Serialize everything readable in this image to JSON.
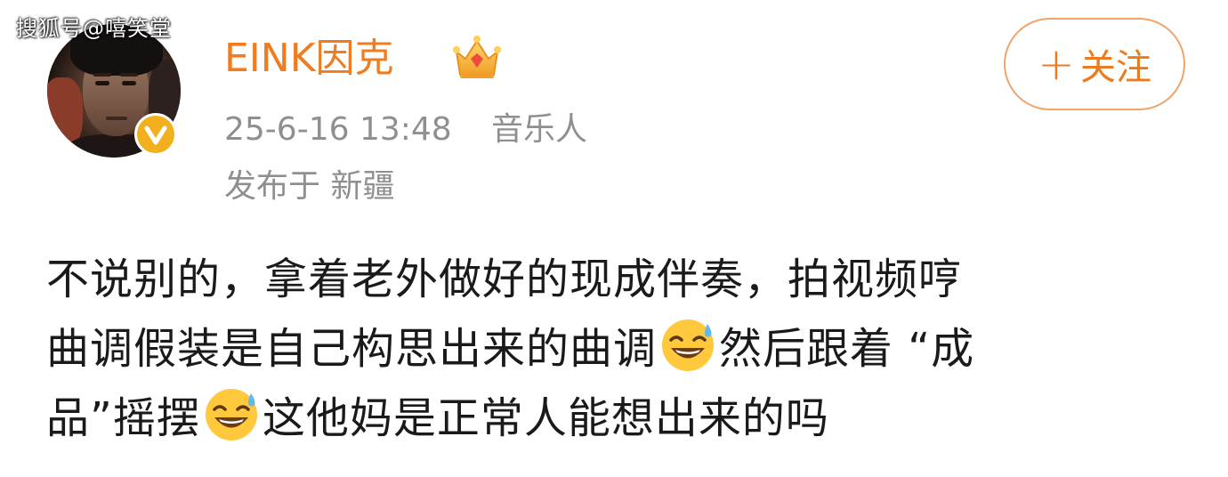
{
  "watermark": "搜狐号@嘻笑堂",
  "user": {
    "name": "EINK因克",
    "badge_icon": "crown-icon",
    "verified_icon": "verified-v-icon",
    "avatar_icon": "man-portrait-avatar"
  },
  "meta": {
    "time": "25-6-16 13:48",
    "role": "音乐人",
    "location": "发布于 新疆"
  },
  "follow_button": {
    "plus": "+",
    "label": "关注"
  },
  "post": {
    "line1": "不说别的，拿着老外做好的现成伴奏，拍视频哼",
    "line2_a": "曲调假装是自己构思出来的曲调",
    "line2_b": "然后跟着 “成",
    "line3_a": "品”摇摆",
    "line3_b": "这他妈是正常人能想出来的吗",
    "emoji_icon": "grinning-sweat-emoji"
  },
  "colors": {
    "accent": "#f07c1f",
    "muted_text": "#8f8f8f",
    "verified": "#f2b01e",
    "body_text": "#1a1a1a"
  }
}
